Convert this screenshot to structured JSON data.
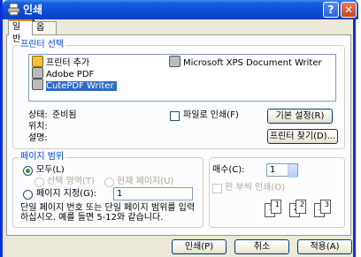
{
  "window": {
    "title": "인쇄",
    "help_btn": "?",
    "close_btn": "✕"
  },
  "tabs": [
    {
      "label": "일반",
      "active": true
    },
    {
      "label": "옵션",
      "active": false
    }
  ],
  "printer_select": {
    "group_label": "프린터 선택",
    "printers": [
      {
        "name": "프린터 추가",
        "icon": "add-printer-icon",
        "selected": false
      },
      {
        "name": "Microsoft XPS Document Writer",
        "icon": "printer-icon",
        "selected": false
      },
      {
        "name": "Adobe PDF",
        "icon": "printer-icon",
        "selected": false
      },
      {
        "name": "CutePDF Writer",
        "icon": "printer-icon",
        "selected": true
      }
    ],
    "status_label": "상태:",
    "status_value": "준비됨",
    "location_label": "위치:",
    "location_value": "",
    "comment_label": "설명:",
    "comment_value": "",
    "print_to_file": "파일로 인쇄(F)",
    "preferences_button": "기본 설정(R)",
    "find_printer_button": "프린터 찾기(D)..."
  },
  "page_range": {
    "group_label": "페이지 범위",
    "all": "모두(L)",
    "selection": "선택 영역(T)",
    "current_page": "현재 페이지(U)",
    "pages": "페이지 지정(G):",
    "pages_value": "1",
    "hint": "단일 페이지 번호 또는 단일 페이지 범위를 입력하십시오. 예를 들면 5-12와 같습니다."
  },
  "copies": {
    "label": "매수(C):",
    "value": "1",
    "collate": "한 부씩 인쇄(O)",
    "collate_pages": [
      "1",
      "1",
      "2",
      "2",
      "3",
      "3"
    ]
  },
  "footer": {
    "print": "인쇄(P)",
    "cancel": "취소",
    "apply": "적용(A)"
  },
  "colors": {
    "title_bar": "#0a4ad4",
    "dialog_bg": "#ece9d8",
    "group_label": "#0046d5",
    "selection": "#316ac5"
  }
}
